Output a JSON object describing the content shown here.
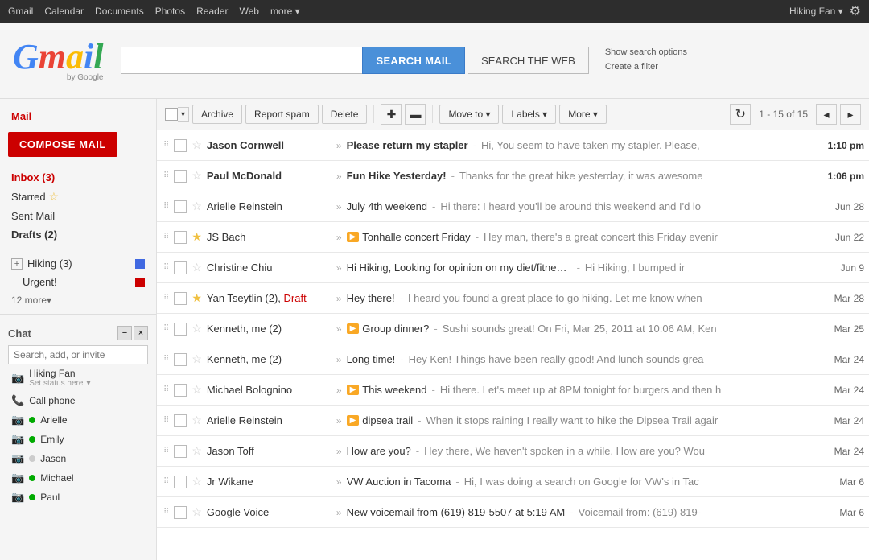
{
  "topnav": {
    "left_items": [
      "Gmail",
      "Calendar",
      "Documents",
      "Photos",
      "Reader",
      "Web",
      "more ▾"
    ],
    "right_user": "Hiking Fan ▾",
    "gear_label": "⚙"
  },
  "header": {
    "logo_g": "G",
    "logo_mail": "mail",
    "logo_bygoogle": "by Google",
    "search_placeholder": "",
    "search_mail_label": "SEARCH MAIL",
    "search_web_label": "SEARCH THE WEB",
    "show_options_label": "Show search options",
    "create_filter_label": "Create a filter"
  },
  "sidebar": {
    "mail_label": "Mail",
    "compose_label": "COMPOSE MAIL",
    "nav_items": [
      {
        "label": "Inbox (3)",
        "key": "inbox",
        "unread": 3
      },
      {
        "label": "Starred",
        "key": "starred",
        "star": true
      },
      {
        "label": "Sent Mail",
        "key": "sent"
      },
      {
        "label": "Drafts (2)",
        "key": "drafts",
        "unread": 2
      }
    ],
    "labels": [
      {
        "label": "Hiking (3)",
        "key": "hiking",
        "dot": "blue"
      },
      {
        "label": "Urgent!",
        "key": "urgent",
        "dot": "red"
      }
    ],
    "more_labels": "12 more▾",
    "chat_title": "Chat",
    "chat_search_placeholder": "Search, add, or invite",
    "chat_users": [
      {
        "name": "Hiking Fan",
        "status": "Set status here",
        "type": "video",
        "online": true
      },
      {
        "name": "Call phone",
        "type": "phone"
      },
      {
        "name": "Arielle",
        "type": "video",
        "online": true
      },
      {
        "name": "Emily",
        "type": "video",
        "online": true
      },
      {
        "name": "Jason",
        "type": "video",
        "online": false
      },
      {
        "name": "Michael",
        "type": "video",
        "online": true
      },
      {
        "name": "Paul",
        "type": "video",
        "online": true
      }
    ]
  },
  "toolbar": {
    "archive_label": "Archive",
    "spam_label": "Report spam",
    "delete_label": "Delete",
    "moveto_label": "Move to ▾",
    "labels_label": "Labels ▾",
    "more_label": "More ▾",
    "page_info": "1 - 15 of 15"
  },
  "emails": [
    {
      "sender": "Jason Cornwell",
      "subject": "Please return my stapler",
      "preview": "Hi, You seem to have taken my stapler. Please,",
      "time": "1:10 pm",
      "unread": true,
      "starred": false,
      "draft": false,
      "promo": false
    },
    {
      "sender": "Paul McDonald",
      "subject": "Fun Hike Yesterday!",
      "preview": "Thanks for the great hike yesterday, it was awesome",
      "time": "1:06 pm",
      "unread": true,
      "starred": false,
      "draft": false,
      "promo": false
    },
    {
      "sender": "Arielle Reinstein",
      "subject": "July 4th weekend",
      "preview": "Hi there: I heard you'll be around this weekend and I'd lo",
      "time": "Jun 28",
      "unread": false,
      "starred": false,
      "draft": false,
      "promo": false
    },
    {
      "sender": "JS Bach",
      "subject": "Tonhalle concert Friday",
      "preview": "Hey man, there's a great concert this Friday evenir",
      "time": "Jun 22",
      "unread": false,
      "starred": true,
      "draft": false,
      "promo": true
    },
    {
      "sender": "Christine Chiu",
      "subject": "Hi Hiking, Looking for opinion on my diet/fitness app",
      "preview": "Hi Hiking, I bumped ir",
      "time": "Jun 9",
      "unread": false,
      "starred": false,
      "draft": false,
      "promo": false
    },
    {
      "sender": "Yan Tseytlin (2), Draft",
      "subject": "Hey there!",
      "preview": "I heard you found a great place to go hiking. Let me know when",
      "time": "Mar 28",
      "unread": false,
      "starred": true,
      "draft": true,
      "promo": false
    },
    {
      "sender": "Kenneth, me (2)",
      "subject": "Group dinner?",
      "preview": "Sushi sounds great! On Fri, Mar 25, 2011 at 10:06 AM, Ken",
      "time": "Mar 25",
      "unread": false,
      "starred": false,
      "draft": false,
      "promo": true
    },
    {
      "sender": "Kenneth, me (2)",
      "subject": "Long time!",
      "preview": "Hey Ken! Things have been really good! And lunch sounds grea",
      "time": "Mar 24",
      "unread": false,
      "starred": false,
      "draft": false,
      "promo": false
    },
    {
      "sender": "Michael Bolognino",
      "subject": "This weekend",
      "preview": "Hi there. Let's meet up at 8PM tonight for burgers and then h",
      "time": "Mar 24",
      "unread": false,
      "starred": false,
      "draft": false,
      "promo": true
    },
    {
      "sender": "Arielle Reinstein",
      "subject": "dipsea trail",
      "preview": "When it stops raining I really want to hike the Dipsea Trail agair",
      "time": "Mar 24",
      "unread": false,
      "starred": false,
      "draft": false,
      "promo": true
    },
    {
      "sender": "Jason Toff",
      "subject": "How are you?",
      "preview": "Hey there, We haven't spoken in a while. How are you? Wou",
      "time": "Mar 24",
      "unread": false,
      "starred": false,
      "draft": false,
      "promo": false
    },
    {
      "sender": "Jr Wikane",
      "subject": "VW Auction in Tacoma",
      "preview": "Hi, I was doing a search on Google for VW's in Tac",
      "time": "Mar 6",
      "unread": false,
      "starred": false,
      "draft": false,
      "promo": false
    },
    {
      "sender": "Google Voice",
      "subject": "New voicemail from (619) 819-5507 at 5:19 AM",
      "preview": "Voicemail from: (619) 819-",
      "time": "Mar 6",
      "unread": false,
      "starred": false,
      "draft": false,
      "promo": false
    }
  ]
}
